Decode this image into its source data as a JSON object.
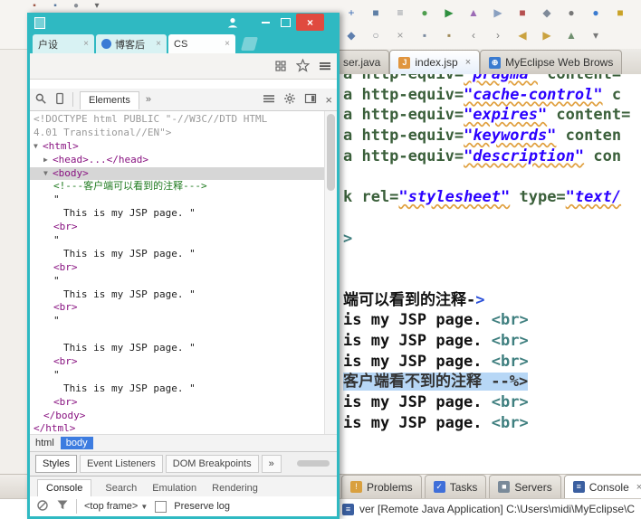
{
  "colors": {
    "browser_frame_teal": "#2fb9c2",
    "close_button_red": "#e04a3f",
    "devtools_tag_purple": "#881280",
    "devtools_comment_green": "#1e7a1e",
    "eclipse_string_blue": "#2a00ff",
    "eclipse_tag_teal": "#3f7f7f",
    "selection_blue": "#b7d7f6",
    "breadcrumb_blue": "#3d7ce0"
  },
  "browser": {
    "window_controls": {
      "minimize": "—",
      "maximize": "",
      "close": "×"
    },
    "tabs": [
      {
        "label": "户设",
        "close": "×"
      },
      {
        "label": "博客后",
        "close": "×",
        "icon": "blog-favicon"
      },
      {
        "label": "CS",
        "close": "×",
        "active": true
      }
    ],
    "devtools": {
      "panel_tab": "Elements",
      "overflow_chevron": "»",
      "dom_rows": [
        {
          "style": "doctype",
          "indent": 0,
          "text": "<!DOCTYPE html PUBLIC \"-//W3C//DTD HTML"
        },
        {
          "style": "doctype",
          "indent": 0,
          "text": "4.01 Transitional//EN\">"
        },
        {
          "style": "tag",
          "indent": 0,
          "arrow": "▼",
          "text": "<html>"
        },
        {
          "style": "tag",
          "indent": 1,
          "arrow": "▶",
          "text": "<head>...</head>"
        },
        {
          "style": "tag",
          "indent": 1,
          "arrow": "▼",
          "text": "<body>",
          "selected": true
        },
        {
          "style": "comment",
          "indent": 2,
          "text": "<!---客户端可以看到的注释--->"
        },
        {
          "style": "text",
          "indent": 2,
          "text": "\""
        },
        {
          "style": "text",
          "indent": 3,
          "text": "This is my JSP page. \""
        },
        {
          "style": "tag",
          "indent": 2,
          "text": "<br>"
        },
        {
          "style": "text",
          "indent": 2,
          "text": "\""
        },
        {
          "style": "text",
          "indent": 3,
          "text": "This is my JSP page. \""
        },
        {
          "style": "tag",
          "indent": 2,
          "text": "<br>"
        },
        {
          "style": "text",
          "indent": 2,
          "text": "\""
        },
        {
          "style": "text",
          "indent": 3,
          "text": "This is my JSP page. \""
        },
        {
          "style": "tag",
          "indent": 2,
          "text": "<br>"
        },
        {
          "style": "text",
          "indent": 2,
          "text": "\""
        },
        {
          "style": "blank",
          "indent": 2,
          "text": ""
        },
        {
          "style": "text",
          "indent": 3,
          "text": "This is my JSP page. \""
        },
        {
          "style": "tag",
          "indent": 2,
          "text": "<br>"
        },
        {
          "style": "text",
          "indent": 2,
          "text": "\""
        },
        {
          "style": "text",
          "indent": 3,
          "text": "This is my JSP page. \""
        },
        {
          "style": "tag",
          "indent": 2,
          "text": "<br>"
        },
        {
          "style": "tag",
          "indent": 1,
          "text": "</body>"
        },
        {
          "style": "tag",
          "indent": 0,
          "text": "</html>"
        }
      ],
      "breadcrumb": [
        {
          "label": "html"
        },
        {
          "label": "body",
          "active": true
        }
      ],
      "side_tabs": [
        {
          "label": "Styles",
          "active": true
        },
        {
          "label": "Event Listeners"
        },
        {
          "label": "DOM Breakpoints"
        },
        {
          "label": "»"
        }
      ],
      "drawer_tabs": [
        {
          "label": "Console",
          "active": true
        },
        {
          "label": "Search"
        },
        {
          "label": "Emulation"
        },
        {
          "label": "Rendering"
        }
      ],
      "frame_select": "<top frame>",
      "preserve_log_label": "Preserve log"
    }
  },
  "ide": {
    "mini_icons": [
      {
        "name": "new-icon",
        "glyph": "▪",
        "color": "#a05a4a"
      },
      {
        "name": "save-all-icon",
        "glyph": "▪",
        "color": "#5a7aa0"
      },
      {
        "name": "search-icon",
        "glyph": "●",
        "color": "#8a8f96"
      },
      {
        "name": "menu-dropdown-icon",
        "glyph": "▾",
        "color": "#666666"
      }
    ],
    "toolbar_row1": [
      {
        "name": "new-wizard-icon",
        "glyph": "+",
        "color": "#3f6fb5"
      },
      {
        "name": "save-icon",
        "glyph": "■",
        "color": "#5f7fa6"
      },
      {
        "name": "print-icon",
        "glyph": "≡",
        "color": "#8a8f98"
      },
      {
        "name": "debug-icon",
        "glyph": "●",
        "color": "#4f9e4f"
      },
      {
        "name": "run-icon",
        "glyph": "▶",
        "color": "#2f8f3f"
      },
      {
        "name": "profile-icon",
        "glyph": "▲",
        "color": "#9c6bb5"
      },
      {
        "name": "external-tools-icon",
        "glyph": "▶",
        "color": "#8aa0c0"
      },
      {
        "name": "coverage-icon",
        "glyph": "■",
        "color": "#b54f4f"
      },
      {
        "name": "new-server-icon",
        "glyph": "◆",
        "color": "#7f8a99"
      },
      {
        "name": "search-icon",
        "glyph": "●",
        "color": "#777777"
      },
      {
        "name": "web-browser-icon",
        "glyph": "●",
        "color": "#3b7bd0"
      },
      {
        "name": "mail-icon",
        "glyph": "■",
        "color": "#c9a227"
      },
      {
        "name": "history-icon",
        "glyph": "▾",
        "color": "#6b9e6b"
      },
      {
        "name": "toolbar-overflow-icon",
        "glyph": "»",
        "color": "#888888"
      }
    ],
    "toolbar_row2": [
      {
        "name": "java-perspective-icon",
        "glyph": "◆",
        "color": "#5f7fae"
      },
      {
        "name": "open-type-icon",
        "glyph": "○",
        "color": "#8a8f96"
      },
      {
        "name": "cut-icon",
        "glyph": "×",
        "color": "#9a9a9a"
      },
      {
        "name": "copy-icon",
        "glyph": "▪",
        "color": "#7a8aa0"
      },
      {
        "name": "paste-icon",
        "glyph": "▪",
        "color": "#a08a5a"
      },
      {
        "name": "undo-icon",
        "glyph": "‹",
        "color": "#7f7f7f"
      },
      {
        "name": "redo-icon",
        "glyph": "›",
        "color": "#7f7f7f"
      },
      {
        "name": "back-icon",
        "glyph": "◀",
        "color": "#caa23f"
      },
      {
        "name": "forward-icon",
        "glyph": "▶",
        "color": "#caa23f"
      },
      {
        "name": "last-edit-icon",
        "glyph": "▲",
        "color": "#6f8f6f"
      },
      {
        "name": "dropdown-icon",
        "glyph": "▾",
        "color": "#777777"
      }
    ],
    "editor_tabs": [
      {
        "label": "ser.java",
        "icon_name": "java-file-icon",
        "icon_glyph": "J",
        "icon_color": "#4f7ad9"
      },
      {
        "label": "index.jsp",
        "active": true,
        "close": "×",
        "icon_name": "jsp-file-icon",
        "icon_glyph": "J",
        "icon_color": "#e0953f"
      },
      {
        "label": "MyEclipse Web Brows",
        "icon_name": "web-browser-icon",
        "icon_glyph": "⊕",
        "icon_color": "#3b7bd0"
      }
    ],
    "code_lines": [
      {
        "segments": [
          {
            "style": "attr",
            "text": "a http-equiv="
          },
          {
            "style": "str",
            "text": "\"pragma\""
          },
          {
            "style": "attr",
            "text": " content="
          }
        ]
      },
      {
        "segments": [
          {
            "style": "attr",
            "text": "a http-equiv="
          },
          {
            "style": "str",
            "text": "\"cache-control\""
          },
          {
            "style": "attr",
            "text": " c"
          }
        ]
      },
      {
        "segments": [
          {
            "style": "attr",
            "text": "a http-equiv="
          },
          {
            "style": "str",
            "text": "\"expires\""
          },
          {
            "style": "attr",
            "text": " content="
          }
        ]
      },
      {
        "segments": [
          {
            "style": "attr",
            "text": "a http-equiv="
          },
          {
            "style": "str",
            "text": "\"keywords\""
          },
          {
            "style": "attr",
            "text": " conten"
          }
        ]
      },
      {
        "segments": [
          {
            "style": "attr",
            "text": "a http-equiv="
          },
          {
            "style": "str",
            "text": "\"description\""
          },
          {
            "style": "attr",
            "text": " con"
          }
        ]
      },
      {
        "segments": []
      },
      {
        "segments": [
          {
            "style": "attr",
            "text": "k rel="
          },
          {
            "style": "str",
            "text": "\"stylesheet\""
          },
          {
            "style": "attr",
            "text": " type="
          },
          {
            "style": "str",
            "text": "\"text/"
          }
        ]
      },
      {
        "segments": []
      },
      {
        "segments": [
          {
            "style": "tag",
            "text": ">"
          }
        ]
      },
      {
        "segments": []
      },
      {
        "segments": []
      },
      {
        "segments": [
          {
            "style": "plain",
            "text": "端可以看到的注释-"
          },
          {
            "style": "arrow",
            "text": ">"
          }
        ]
      },
      {
        "segments": [
          {
            "style": "plain",
            "text": "is my JSP page. "
          },
          {
            "style": "tag",
            "text": "<br>"
          }
        ]
      },
      {
        "segments": [
          {
            "style": "plain",
            "text": "is my JSP page. "
          },
          {
            "style": "tag",
            "text": "<br>"
          }
        ]
      },
      {
        "segments": [
          {
            "style": "plain",
            "text": "is my JSP page. "
          },
          {
            "style": "tag",
            "text": "<br>"
          }
        ]
      },
      {
        "selected": true,
        "segments": [
          {
            "style": "jsp-comment",
            "text": "客户端看不到的注释 --%>"
          }
        ]
      },
      {
        "segments": [
          {
            "style": "plain",
            "text": "is my JSP page. "
          },
          {
            "style": "tag",
            "text": "<br>"
          }
        ]
      },
      {
        "segments": [
          {
            "style": "plain",
            "text": "is my JSP page. "
          },
          {
            "style": "tag",
            "text": "<br>"
          }
        ]
      }
    ],
    "bottom_tabs": [
      {
        "label": "Problems",
        "icon_name": "problems-icon",
        "glyph": "!",
        "color": "#d9a03f"
      },
      {
        "label": "Tasks",
        "icon_name": "tasks-icon",
        "glyph": "✓",
        "color": "#3f6fd9"
      },
      {
        "label": "Servers",
        "icon_name": "servers-icon",
        "glyph": "■",
        "color": "#7a8a99"
      },
      {
        "label": "Console",
        "icon_name": "console-icon",
        "glyph": "≡",
        "color": "#3b5fa0",
        "active": true,
        "close": "×"
      }
    ],
    "status_text": "ver [Remote Java Application] C:\\Users\\midi\\MyEclipse\\C"
  }
}
